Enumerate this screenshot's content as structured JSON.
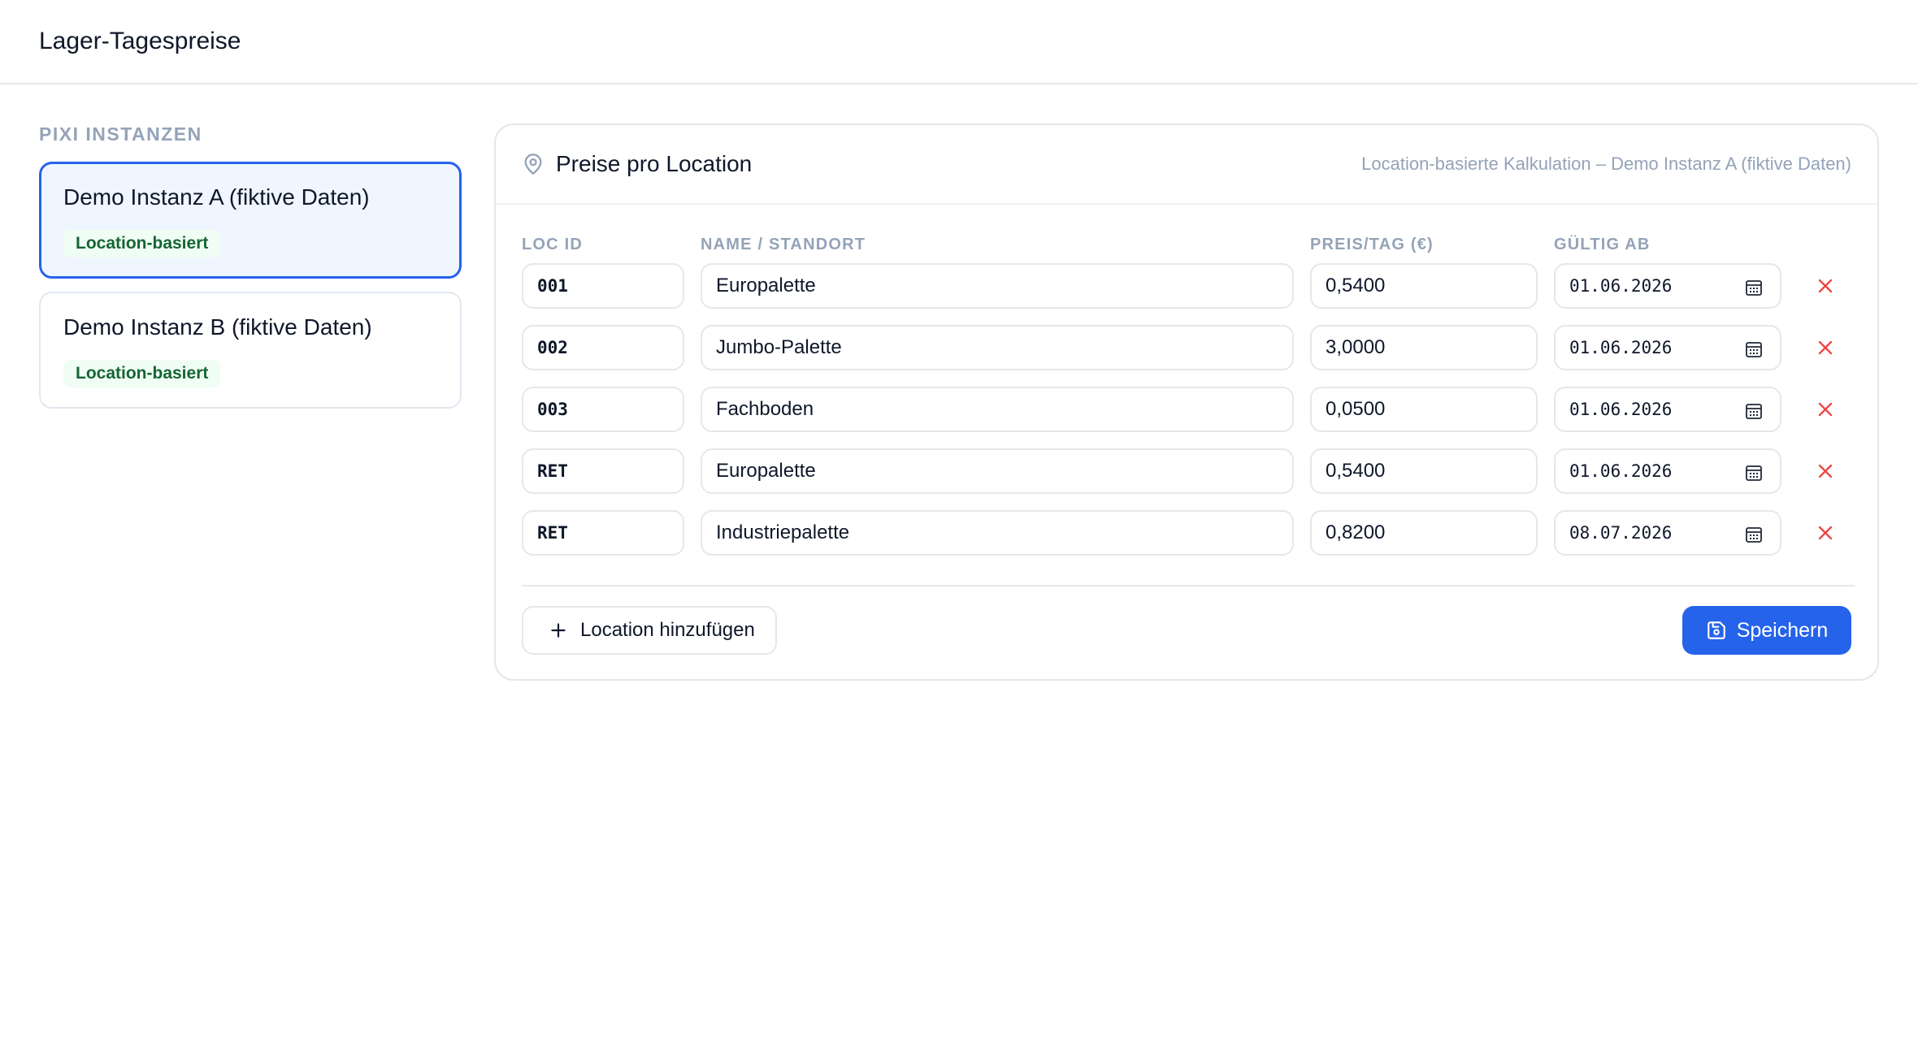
{
  "header": {
    "title": "Lager-Tagespreise"
  },
  "sidebar": {
    "heading": "PIXI INSTANZEN",
    "instances": [
      {
        "name": "Demo Instanz A (fiktive Daten)",
        "badge": "Location-basiert",
        "active": true
      },
      {
        "name": "Demo Instanz B (fiktive Daten)",
        "badge": "Location-basiert",
        "active": false
      }
    ]
  },
  "panel": {
    "title": "Preise pro Location",
    "subtitle": "Location-basierte Kalkulation – Demo Instanz A (fiktive Daten)",
    "columns": {
      "loc_id": "LOC ID",
      "name": "NAME / STANDORT",
      "price": "PREIS/TAG (€)",
      "valid_from": "GÜLTIG AB"
    },
    "rows": [
      {
        "loc_id": "001",
        "name": "Europalette",
        "price": "0,5400",
        "valid_from": "01.06.2026"
      },
      {
        "loc_id": "002",
        "name": "Jumbo-Palette",
        "price": "3,0000",
        "valid_from": "01.06.2026"
      },
      {
        "loc_id": "003",
        "name": "Fachboden",
        "price": "0,0500",
        "valid_from": "01.06.2026"
      },
      {
        "loc_id": "RET",
        "name": "Europalette",
        "price": "0,5400",
        "valid_from": "01.06.2026"
      },
      {
        "loc_id": "RET",
        "name": "Industriepalette",
        "price": "0,8200",
        "valid_from": "08.07.2026"
      }
    ],
    "add_label": "Location hinzufügen",
    "save_label": "Speichern"
  },
  "colors": {
    "accent": "#2563eb",
    "delete": "#ef4444",
    "badge_text": "#166534",
    "badge_bg": "#f0fdf4"
  },
  "icons": {
    "location": "map-pin-icon",
    "calendar": "calendar-icon",
    "delete": "close-icon",
    "add": "plus-icon",
    "save": "save-icon"
  }
}
